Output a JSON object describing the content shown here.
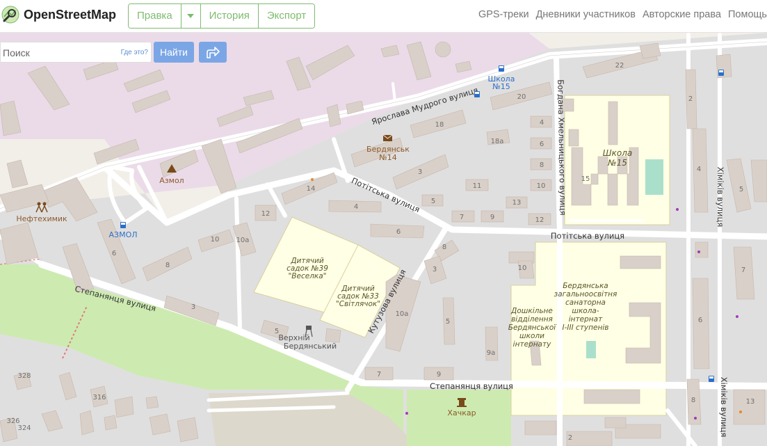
{
  "header": {
    "logo_text": "OpenStreetMap",
    "edit_label": "Правка",
    "history_label": "История",
    "export_label": "Экспорт",
    "links": [
      "GPS-треки",
      "Дневники участников",
      "Авторские права",
      "Помощь"
    ]
  },
  "search": {
    "placeholder": "Поиск",
    "where_label": "Где это?",
    "submit_label": "Найти"
  },
  "colors": {
    "accent": "#7ebc6f",
    "button_blue": "#7ba6e6",
    "industrial": "#ebdbe8",
    "building": "#d9d0c9",
    "school": "#ffffe5",
    "grass": "#cdebb0"
  },
  "map": {
    "streets": {
      "yaroslava": "Ярослава Мудрого вулиця",
      "bohdana": "Богдана Хмельницького вулиця",
      "potitska_1": "Потітська вулиця",
      "potitska_2": "Потітська вулиця",
      "stepanyantsia_1": "Степанянця вулиця",
      "stepanyantsia_2": "Степанянця вулиця",
      "kutuzova": "Кутузова вулиця",
      "khimikiv_1": "Хіміків вулиця",
      "khimikiv_2": "Хіміків вулиця"
    },
    "pois": {
      "shkola_stop_1": "Школа",
      "shkola_stop_2": "№15",
      "post_1": "Бердянськ",
      "post_2": "№14",
      "azmol": "Азмол",
      "azmol_stop": "АЗМОЛ",
      "neftekhimik": "Нефтехимик",
      "school15_1": "Школа",
      "school15_2": "№15",
      "kg39_1": "Дитячий",
      "kg39_2": "садок №39",
      "kg39_3": "\"Веселка\"",
      "kg33_1": "Дитячий",
      "kg33_2": "садок №33",
      "kg33_3": "\"Світлячок\"",
      "berd_school_1": "Бердянська",
      "berd_school_2": "загальноосвітня",
      "berd_school_3": "санаторна",
      "berd_school_4": "школа-",
      "berd_school_5": "інтернат",
      "berd_school_6": "І-ІІІ ступенів",
      "preschool_1": "Дошкільне",
      "preschool_2": "відділення",
      "preschool_3": "Бердянської",
      "preschool_4": "школи",
      "preschool_5": "інтернату",
      "verkhnii_1": "Верхній",
      "verkhnii_2": "Бердянський",
      "khachkar": "Хачкар"
    },
    "house_numbers": [
      "22",
      "20",
      "18",
      "18a",
      "4",
      "6",
      "8",
      "10",
      "11",
      "12",
      "13",
      "3",
      "5",
      "7",
      "9",
      "2",
      "4",
      "5",
      "14",
      "12",
      "10",
      "10a",
      "6",
      "8",
      "3",
      "4",
      "6",
      "8",
      "3",
      "5",
      "10a",
      "10",
      "15",
      "5",
      "9a",
      "7",
      "9",
      "7",
      "6",
      "8",
      "13",
      "2",
      "328",
      "316",
      "326",
      "324"
    ]
  }
}
